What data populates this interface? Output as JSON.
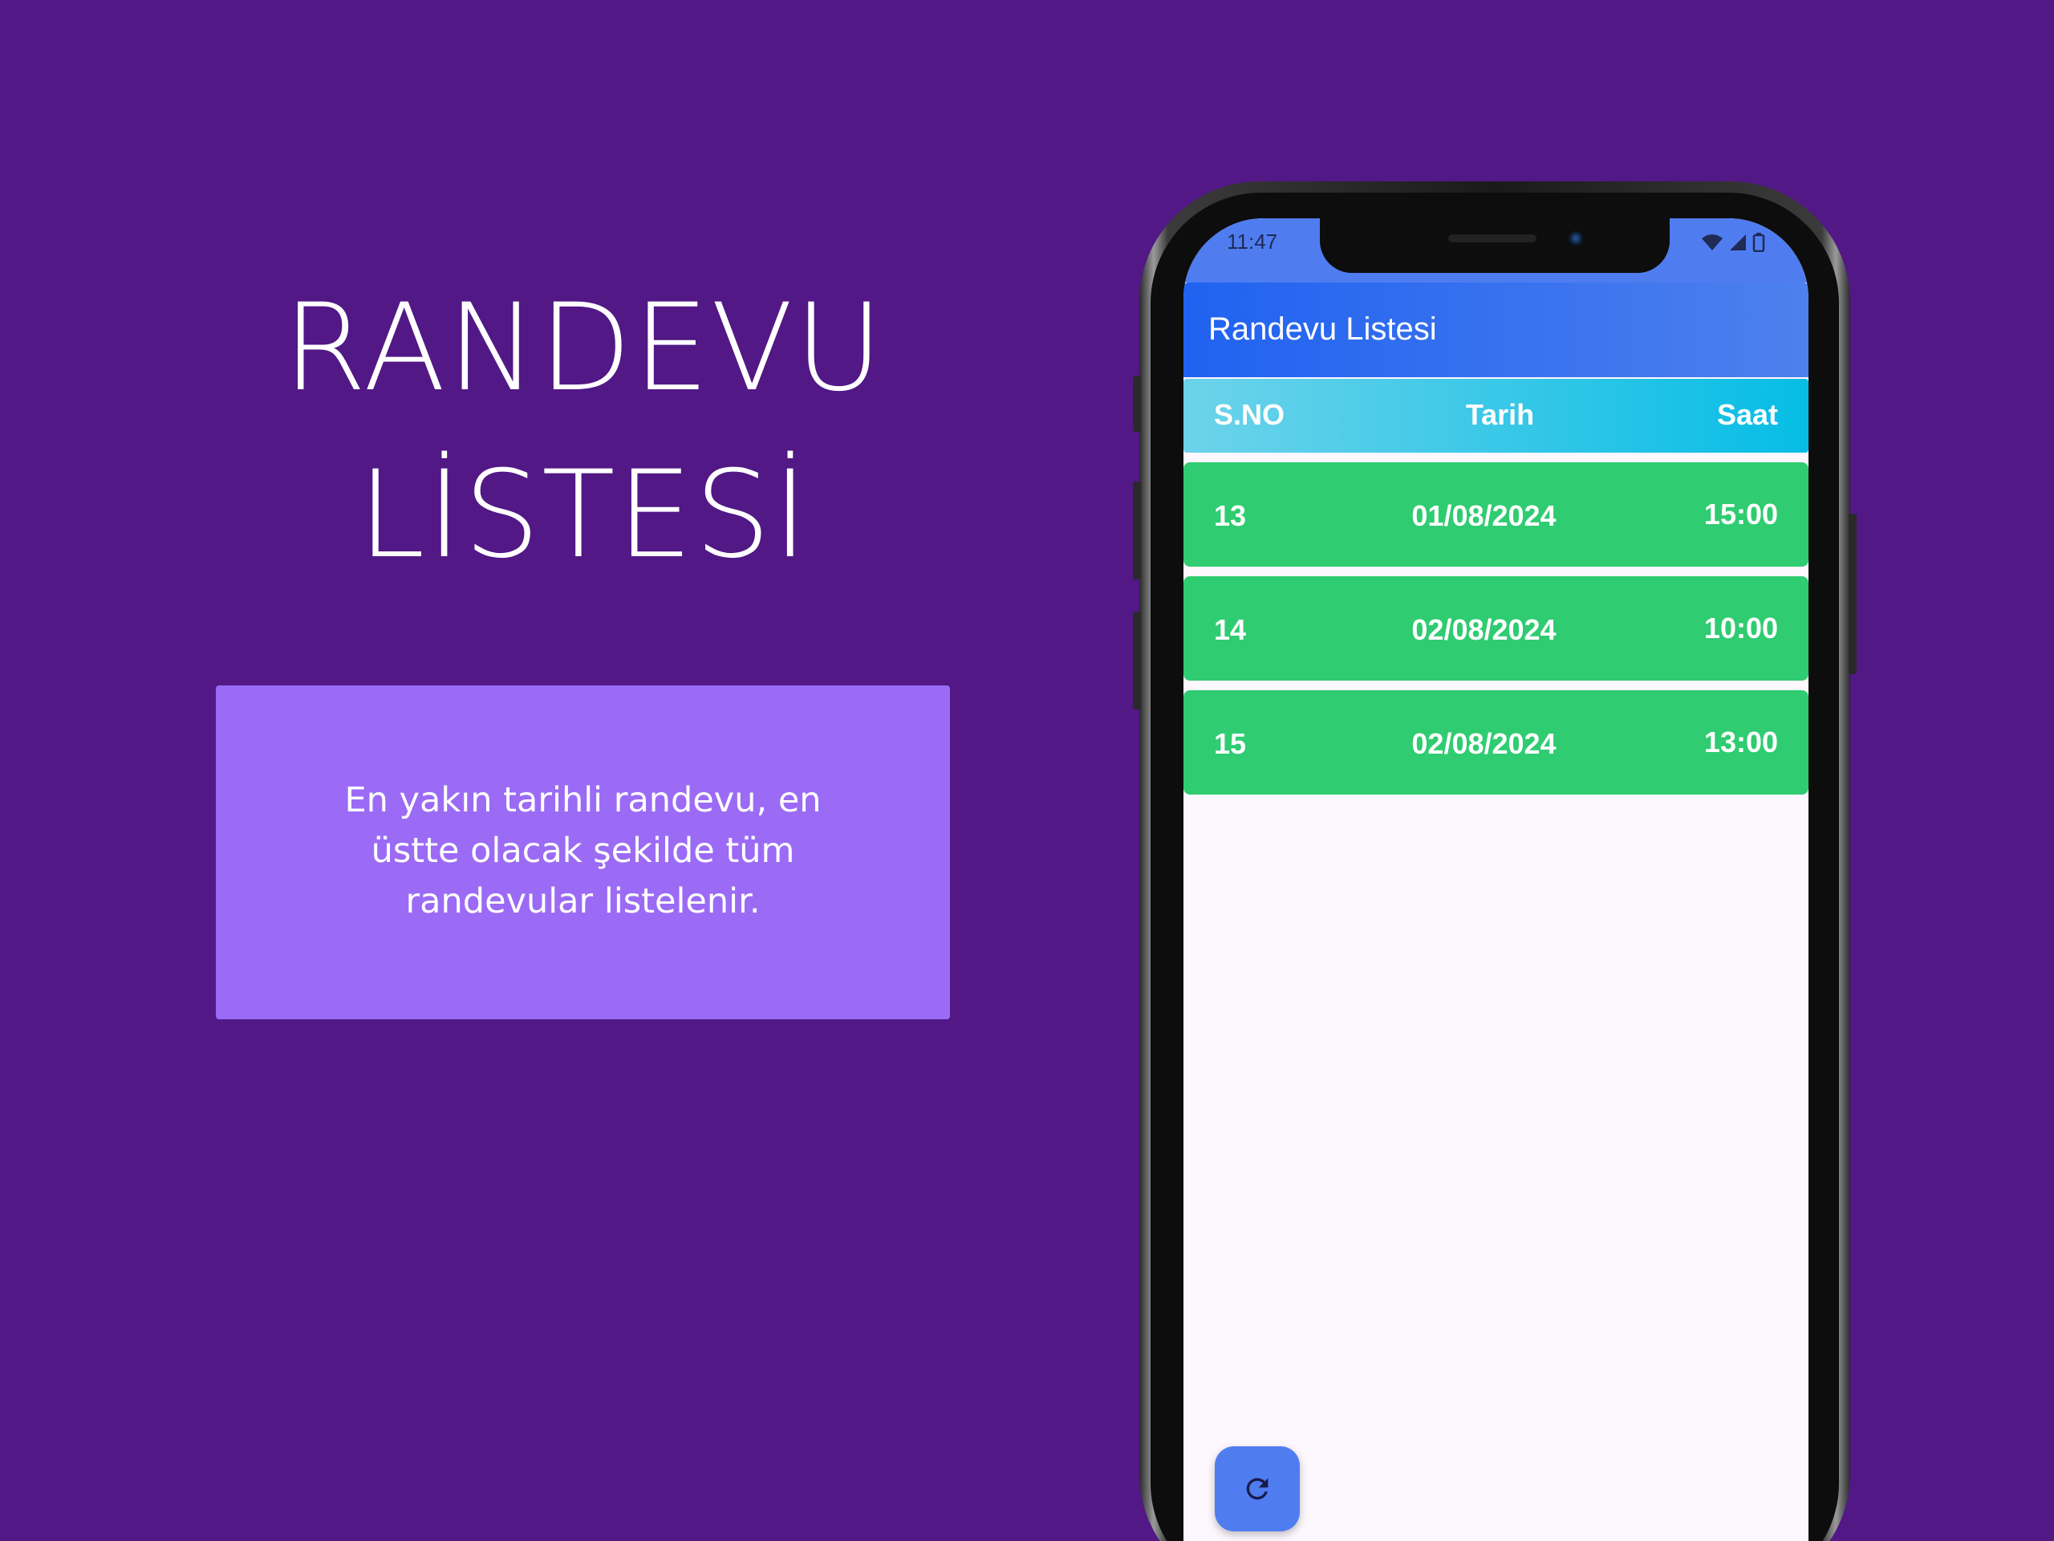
{
  "hero": {
    "title_line1": "RANDEVU",
    "title_line2": "LİSTESİ"
  },
  "description": "En yakın tarihli randevu, en üstte olacak şekilde tüm randevular listelenir.",
  "phone": {
    "status_bar": {
      "time": "11:47",
      "icons": [
        "wifi-icon",
        "signal-icon",
        "battery-icon"
      ]
    },
    "app_bar": {
      "title": "Randevu Listesi"
    },
    "table": {
      "headers": [
        "S.NO",
        "Tarih",
        "Saat"
      ],
      "rows": [
        {
          "sno": "13",
          "date": "01/08/2024",
          "time": "15:00"
        },
        {
          "sno": "14",
          "date": "02/08/2024",
          "time": "10:00"
        },
        {
          "sno": "15",
          "date": "02/08/2024",
          "time": "13:00"
        }
      ]
    },
    "fab_icon": "refresh-icon"
  },
  "colors": {
    "background": "#511886",
    "description_box": "#9b6bf5",
    "app_bar": "#2062f0",
    "table_header": "#06bde5",
    "row": "#2fcc71",
    "fab": "#4f7df0"
  }
}
